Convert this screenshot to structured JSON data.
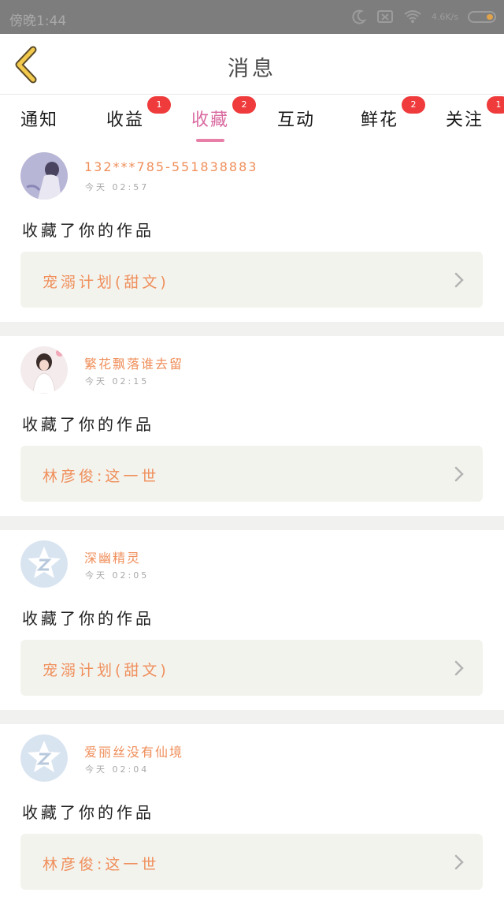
{
  "status_bar": {
    "time": "傍晚1:44",
    "speed": "4.6K/s"
  },
  "header": {
    "title": "消息"
  },
  "tabs": [
    {
      "label": "通知",
      "badge": ""
    },
    {
      "label": "收益",
      "badge": "1"
    },
    {
      "label": "收藏",
      "badge": "2",
      "active": true
    },
    {
      "label": "互动",
      "badge": ""
    },
    {
      "label": "鲜花",
      "badge": "2"
    },
    {
      "label": "关注",
      "badge": "1"
    }
  ],
  "items": [
    {
      "name": "132***785-551838883",
      "time": "今天 02:57",
      "action": "收藏了你的作品",
      "work": "宠溺计划(甜文)",
      "avatar": "photo-girl"
    },
    {
      "name": "繁花飘落谁去留",
      "time": "今天 02:15",
      "action": "收藏了你的作品",
      "work": "林彦俊:这一世",
      "avatar": "photo-girl-white"
    },
    {
      "name": "深幽精灵",
      "time": "今天 02:05",
      "action": "收藏了你的作品",
      "work": "宠溺计划(甜文)",
      "avatar": "default-qq-avatar"
    },
    {
      "name": "爱丽丝没有仙境",
      "time": "今天 02:04",
      "action": "收藏了你的作品",
      "work": "林彦俊:这一世",
      "avatar": "default-qq-avatar"
    }
  ],
  "colors": {
    "accent_pink": "#e77fa9",
    "name_orange": "#ef8f5b",
    "badge_red": "#ef3b3b",
    "back_yellow": "#f2c94c"
  }
}
